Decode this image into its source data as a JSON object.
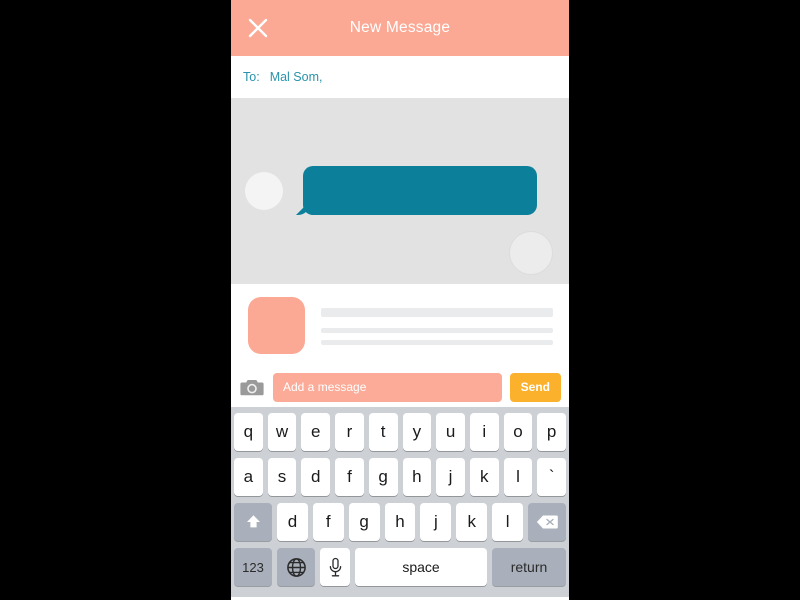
{
  "header": {
    "title": "New Message",
    "close_icon": "close-icon",
    "background_color": "#fba894",
    "title_color": "#ffffff"
  },
  "recipients": {
    "label": "To:",
    "value": "Mal Som,",
    "text_color": "#2a93ab"
  },
  "conversation": {
    "background_color": "#e2e2e2",
    "bubble_color": "#0c7f9b",
    "avatar_left_color": "#f4f4f4",
    "avatar_right_color": "#ececec"
  },
  "preview_card": {
    "thumbnail_color": "#fba894",
    "placeholder_line_color": "#e9ebed"
  },
  "input_bar": {
    "camera_icon": "camera-icon",
    "message_placeholder": "Add a message",
    "message_value": "",
    "input_color": "#fbab97",
    "send_label": "Send",
    "send_color": "#fcb12c"
  },
  "keyboard": {
    "background_color": "#cdd1d6",
    "rows": [
      {
        "keys": [
          {
            "label": "q",
            "name": "key-q",
            "type": "letter"
          },
          {
            "label": "w",
            "name": "key-w",
            "type": "letter"
          },
          {
            "label": "e",
            "name": "key-e",
            "type": "letter"
          },
          {
            "label": "r",
            "name": "key-r",
            "type": "letter"
          },
          {
            "label": "t",
            "name": "key-t",
            "type": "letter"
          },
          {
            "label": "y",
            "name": "key-y",
            "type": "letter"
          },
          {
            "label": "u",
            "name": "key-u",
            "type": "letter"
          },
          {
            "label": "i",
            "name": "key-i",
            "type": "letter"
          },
          {
            "label": "o",
            "name": "key-o",
            "type": "letter"
          },
          {
            "label": "p",
            "name": "key-p",
            "type": "letter"
          }
        ]
      },
      {
        "keys": [
          {
            "label": "a",
            "name": "key-a",
            "type": "letter"
          },
          {
            "label": "s",
            "name": "key-s",
            "type": "letter"
          },
          {
            "label": "d",
            "name": "key-d",
            "type": "letter"
          },
          {
            "label": "f",
            "name": "key-f",
            "type": "letter"
          },
          {
            "label": "g",
            "name": "key-g",
            "type": "letter"
          },
          {
            "label": "h",
            "name": "key-h",
            "type": "letter"
          },
          {
            "label": "j",
            "name": "key-j",
            "type": "letter"
          },
          {
            "label": "k",
            "name": "key-k",
            "type": "letter"
          },
          {
            "label": "l",
            "name": "key-l",
            "type": "letter"
          },
          {
            "label": "`",
            "name": "key-backtick",
            "type": "letter"
          }
        ]
      },
      {
        "keys": [
          {
            "label": "",
            "name": "key-shift",
            "type": "shift"
          },
          {
            "label": "d",
            "name": "key-d-2",
            "type": "letter"
          },
          {
            "label": "f",
            "name": "key-f-2",
            "type": "letter"
          },
          {
            "label": "g",
            "name": "key-g-2",
            "type": "letter"
          },
          {
            "label": "h",
            "name": "key-h-2",
            "type": "letter"
          },
          {
            "label": "j",
            "name": "key-j-2",
            "type": "letter"
          },
          {
            "label": "k",
            "name": "key-k-2",
            "type": "letter"
          },
          {
            "label": "l",
            "name": "key-l-2",
            "type": "letter"
          },
          {
            "label": "",
            "name": "key-backspace",
            "type": "backspace"
          }
        ]
      },
      {
        "keys": [
          {
            "label": "123",
            "name": "key-numbers",
            "type": "fn-dark"
          },
          {
            "label": "",
            "name": "key-globe",
            "type": "globe"
          },
          {
            "label": "",
            "name": "key-microphone",
            "type": "mic"
          },
          {
            "label": "space",
            "name": "key-space",
            "type": "space"
          },
          {
            "label": "return",
            "name": "key-return",
            "type": "return"
          }
        ]
      }
    ]
  }
}
